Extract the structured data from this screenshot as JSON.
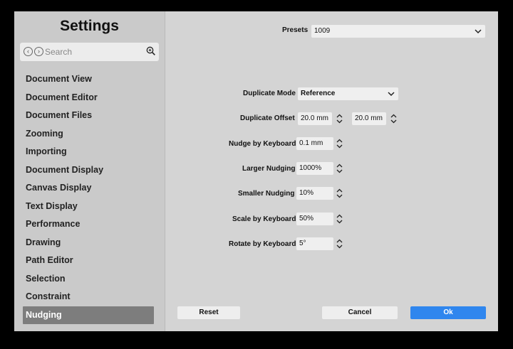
{
  "sidebar": {
    "title": "Settings",
    "search_placeholder": "Search",
    "items": [
      {
        "label": "Document View"
      },
      {
        "label": "Document Editor"
      },
      {
        "label": "Document Files"
      },
      {
        "label": "Zooming"
      },
      {
        "label": "Importing"
      },
      {
        "label": "Document Display"
      },
      {
        "label": "Canvas Display"
      },
      {
        "label": "Text Display"
      },
      {
        "label": "Performance"
      },
      {
        "label": "Drawing"
      },
      {
        "label": "Path Editor"
      },
      {
        "label": "Selection"
      },
      {
        "label": "Constraint"
      },
      {
        "label": "Nudging"
      }
    ],
    "active_item": "Nudging"
  },
  "presets": {
    "label": "Presets",
    "value": "1009"
  },
  "form": {
    "duplicate_mode": {
      "label": "Duplicate Mode",
      "value": "Reference"
    },
    "duplicate_offset": {
      "label": "Duplicate Offset",
      "x": "20.0 mm",
      "y": "20.0 mm"
    },
    "nudge_by_keyboard": {
      "label": "Nudge by Keyboard",
      "value": "0.1 mm"
    },
    "larger_nudging": {
      "label": "Larger Nudging",
      "value": "1000%"
    },
    "smaller_nudging": {
      "label": "Smaller Nudging",
      "value": "10%"
    },
    "scale_by_keyboard": {
      "label": "Scale by Keyboard",
      "value": "50%"
    },
    "rotate_by_keyboard": {
      "label": "Rotate by Keyboard",
      "value": "5°"
    }
  },
  "buttons": {
    "reset": "Reset",
    "cancel": "Cancel",
    "ok": "Ok"
  },
  "colors": {
    "accent": "#2f86ee",
    "active_item_bg": "#7d7d7d",
    "window_bg": "#d4d4d4",
    "sidebar_bg": "#cacaca"
  }
}
